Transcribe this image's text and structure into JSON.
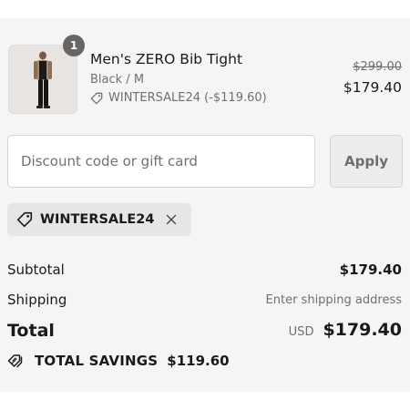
{
  "product": {
    "name": "Men's ZERO Bib Tight",
    "variant": "Black / M",
    "discount_label": "WINTERSALE24 (-$119.60)",
    "compare_price": "$299.00",
    "price": "$179.40",
    "quantity": "1",
    "image_icon": "product-photo"
  },
  "discount": {
    "placeholder": "Discount code or gift card",
    "value": "",
    "apply_label": "Apply",
    "applied_code": "WINTERSALE24"
  },
  "summary": {
    "subtotal_label": "Subtotal",
    "subtotal_value": "$179.40",
    "shipping_label": "Shipping",
    "shipping_value": "Enter shipping address",
    "total_label": "Total",
    "currency": "USD",
    "total_value": "$179.40",
    "savings_label": "TOTAL SAVINGS",
    "savings_value": "$119.60"
  },
  "colors": {
    "panel_bg": "#f5f5f5",
    "muted_text": "#707070",
    "badge_bg": "#666666"
  }
}
